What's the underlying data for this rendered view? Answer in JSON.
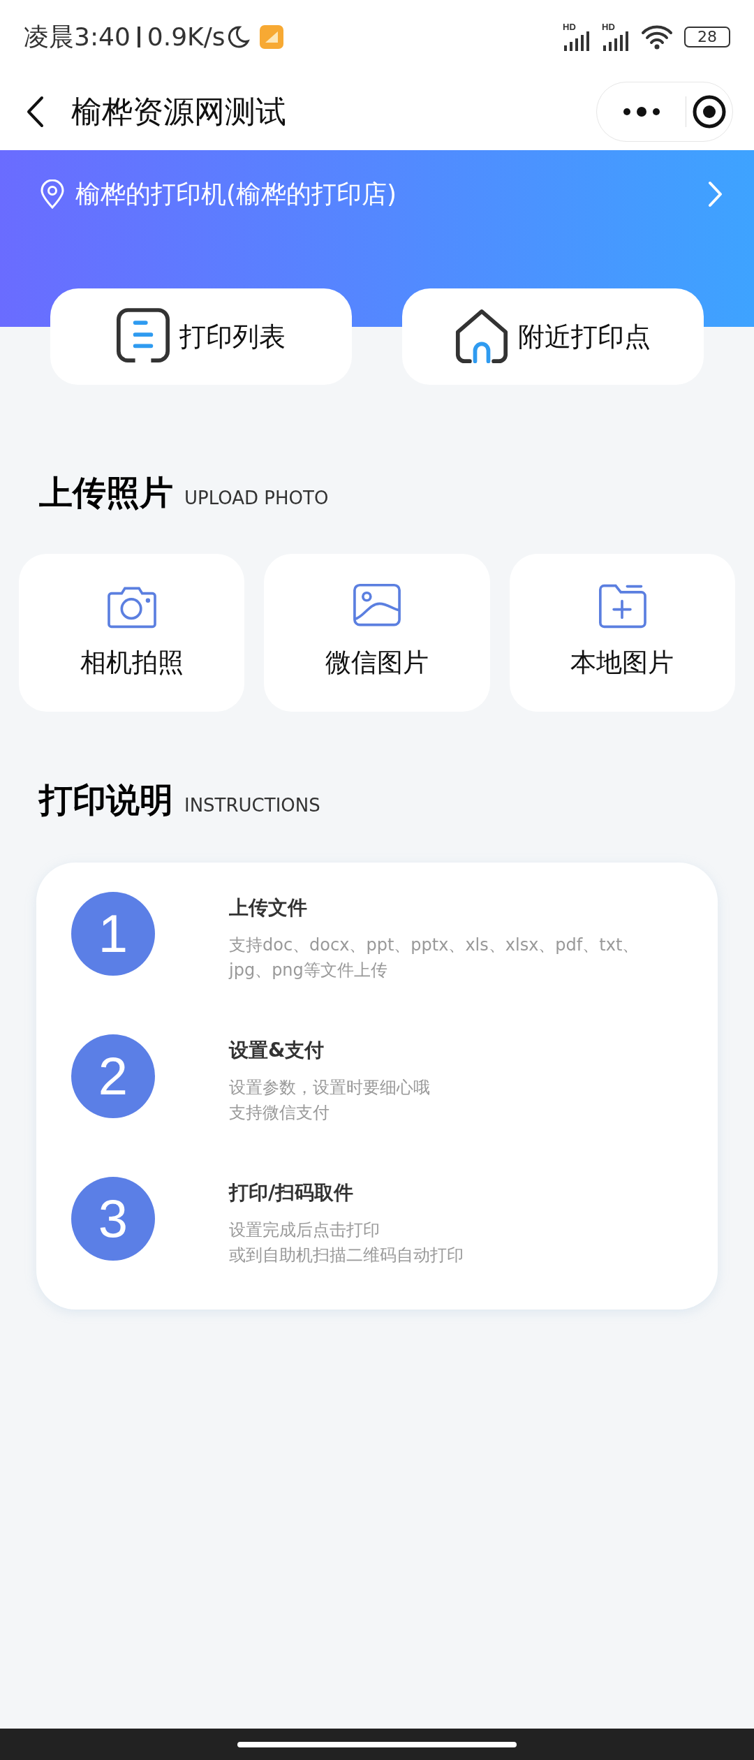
{
  "status_bar": {
    "time": "凌晨3:40",
    "speed": "0.9K/s",
    "battery": "28",
    "signal_labels": [
      "HD",
      "HD"
    ]
  },
  "header": {
    "title": "榆桦资源网测试"
  },
  "location": {
    "text": "榆桦的打印机(榆桦的打印店)"
  },
  "quick_actions": [
    {
      "label": "打印列表",
      "kind": "list"
    },
    {
      "label": "附近打印点",
      "kind": "home"
    }
  ],
  "upload": {
    "title": "上传照片",
    "subtitle": "UPLOAD PHOTO",
    "items": [
      {
        "label": "相机拍照",
        "kind": "camera"
      },
      {
        "label": "微信图片",
        "kind": "image"
      },
      {
        "label": "本地图片",
        "kind": "folder"
      }
    ]
  },
  "instructions": {
    "title": "打印说明",
    "subtitle": "INSTRUCTIONS",
    "steps": [
      {
        "number": "1",
        "title": "上传文件",
        "lines": [
          "支持doc、docx、ppt、pptx、xls、xlsx、pdf、txt、",
          "jpg、png等文件上传"
        ]
      },
      {
        "number": "2",
        "title": "设置&支付",
        "lines": [
          "设置参数，设置时要细心哦",
          "支持微信支付"
        ]
      },
      {
        "number": "3",
        "title": "打印/扫码取件",
        "lines": [
          "设置完成后点击打印",
          "或到自助机扫描二维码自动打印"
        ]
      }
    ]
  }
}
